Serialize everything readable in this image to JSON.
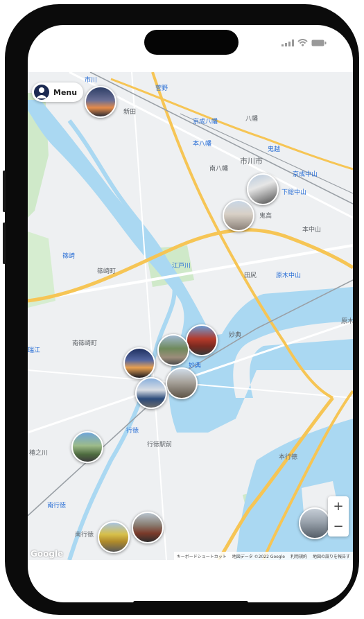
{
  "menu": {
    "label": "Menu"
  },
  "zoom": {
    "in_label": "+",
    "out_label": "−"
  },
  "attribution": {
    "logo": "Google",
    "shortcuts": "キーボードショートカット",
    "map_data": "地図データ ©2022 Google",
    "terms": "利用規約",
    "report": "地図の誤りを報告す"
  },
  "map_labels": [
    {
      "id": "ichikawa-station",
      "text": "市川",
      "kind": "blue"
    },
    {
      "id": "sugano",
      "text": "菅野",
      "kind": "blue"
    },
    {
      "id": "shinden",
      "text": "新田",
      "kind": "gray"
    },
    {
      "id": "yawata",
      "text": "八幡",
      "kind": "gray"
    },
    {
      "id": "keisei-yawata",
      "text": "京成八幡",
      "kind": "blue"
    },
    {
      "id": "motoyawata",
      "text": "本八幡",
      "kind": "blue"
    },
    {
      "id": "onitaka-station",
      "text": "鬼越",
      "kind": "blue"
    },
    {
      "id": "ichikawa-city",
      "text": "市川市",
      "kind": "gray"
    },
    {
      "id": "minami-yawata",
      "text": "南八幡",
      "kind": "gray"
    },
    {
      "id": "keisei-nakayama",
      "text": "京成中山",
      "kind": "blue"
    },
    {
      "id": "shimosa-nakayama",
      "text": "下総中山",
      "kind": "blue"
    },
    {
      "id": "onitaka",
      "text": "鬼高",
      "kind": "gray"
    },
    {
      "id": "motonakayama",
      "text": "本中山",
      "kind": "gray"
    },
    {
      "id": "shinozaki",
      "text": "篠崎",
      "kind": "blue"
    },
    {
      "id": "shinozakicho",
      "text": "篠崎町",
      "kind": "gray"
    },
    {
      "id": "edogawa",
      "text": "江戸川",
      "kind": "blue"
    },
    {
      "id": "tajiri",
      "text": "田尻",
      "kind": "gray"
    },
    {
      "id": "baragi-nakayama",
      "text": "原木中山",
      "kind": "blue"
    },
    {
      "id": "mizue",
      "text": "瑞江",
      "kind": "blue"
    },
    {
      "id": "minami-shinozakicho",
      "text": "南篠崎町",
      "kind": "gray"
    },
    {
      "id": "myoden",
      "text": "妙典",
      "kind": "gray"
    },
    {
      "id": "myoden-station",
      "text": "妙典",
      "kind": "blue"
    },
    {
      "id": "gyotoku",
      "text": "行徳",
      "kind": "blue"
    },
    {
      "id": "gyotoku-ekimae",
      "text": "行徳駅前",
      "kind": "gray"
    },
    {
      "id": "nenoegawa",
      "text": "椿之川",
      "kind": "gray"
    },
    {
      "id": "hongyotoku",
      "text": "本行徳",
      "kind": "gray"
    },
    {
      "id": "minami-gyotoku-station",
      "text": "南行徳",
      "kind": "blue"
    },
    {
      "id": "minami-gyotoku",
      "text": "南行徳",
      "kind": "gray"
    },
    {
      "id": "hara",
      "text": "原木",
      "kind": "gray"
    }
  ]
}
